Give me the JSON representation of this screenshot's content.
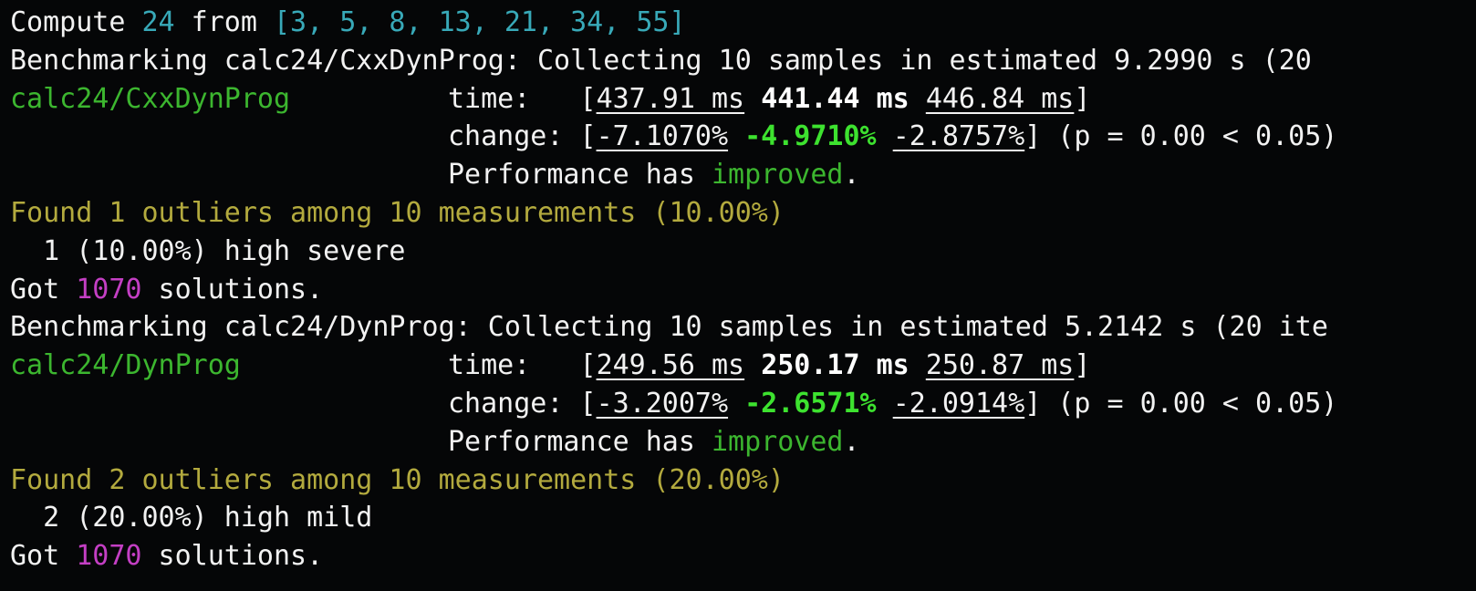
{
  "header": {
    "prefix": "Compute ",
    "target": "24",
    "mid": " from ",
    "numbers": "[3, 5, 8, 13, 21, 34, 55]"
  },
  "benchmarks": [
    {
      "collecting_line": "Benchmarking calc24/CxxDynProg: Collecting 10 samples in estimated 9.2990 s (20",
      "name": "calc24/CxxDynProg",
      "time_label": "time:   ",
      "time_low": "437.91 ms",
      "time_mid": "441.44 ms",
      "time_high": "446.84 ms",
      "change_label": "change: ",
      "change_low": "-7.1070%",
      "change_mid": "-4.9710%",
      "change_high": "-2.8757%",
      "p_text": " (p = 0.00 < 0.05)",
      "perf_prefix": "Performance has ",
      "perf_status": "improved",
      "perf_suffix": ".",
      "outliers_summary": "Found 1 outliers among 10 measurements (10.00%)",
      "outliers_detail": "  1 (10.00%) high severe",
      "solutions_prefix": "Got ",
      "solutions_count": "1070",
      "solutions_suffix": " solutions."
    },
    {
      "collecting_line": "Benchmarking calc24/DynProg: Collecting 10 samples in estimated 5.2142 s (20 ite",
      "name": "calc24/DynProg",
      "time_label": "time:   ",
      "time_low": "249.56 ms",
      "time_mid": "250.17 ms",
      "time_high": "250.87 ms",
      "change_label": "change: ",
      "change_low": "-3.2007%",
      "change_mid": "-2.6571%",
      "change_high": "-2.0914%",
      "p_text": " (p = 0.00 < 0.05)",
      "perf_prefix": "Performance has ",
      "perf_status": "improved",
      "perf_suffix": ".",
      "outliers_summary": "Found 2 outliers among 10 measurements (20.00%)",
      "outliers_detail": "  2 (20.00%) high mild",
      "solutions_prefix": "Got ",
      "solutions_count": "1070",
      "solutions_suffix": " solutions."
    }
  ],
  "colors": {
    "background": "#050607",
    "text": "#f2f2f2",
    "cyan": "#38a9b8",
    "green": "#3cb62f",
    "bright_green": "#3de22f",
    "yellow": "#b3aa3e",
    "magenta": "#c43fc4"
  }
}
